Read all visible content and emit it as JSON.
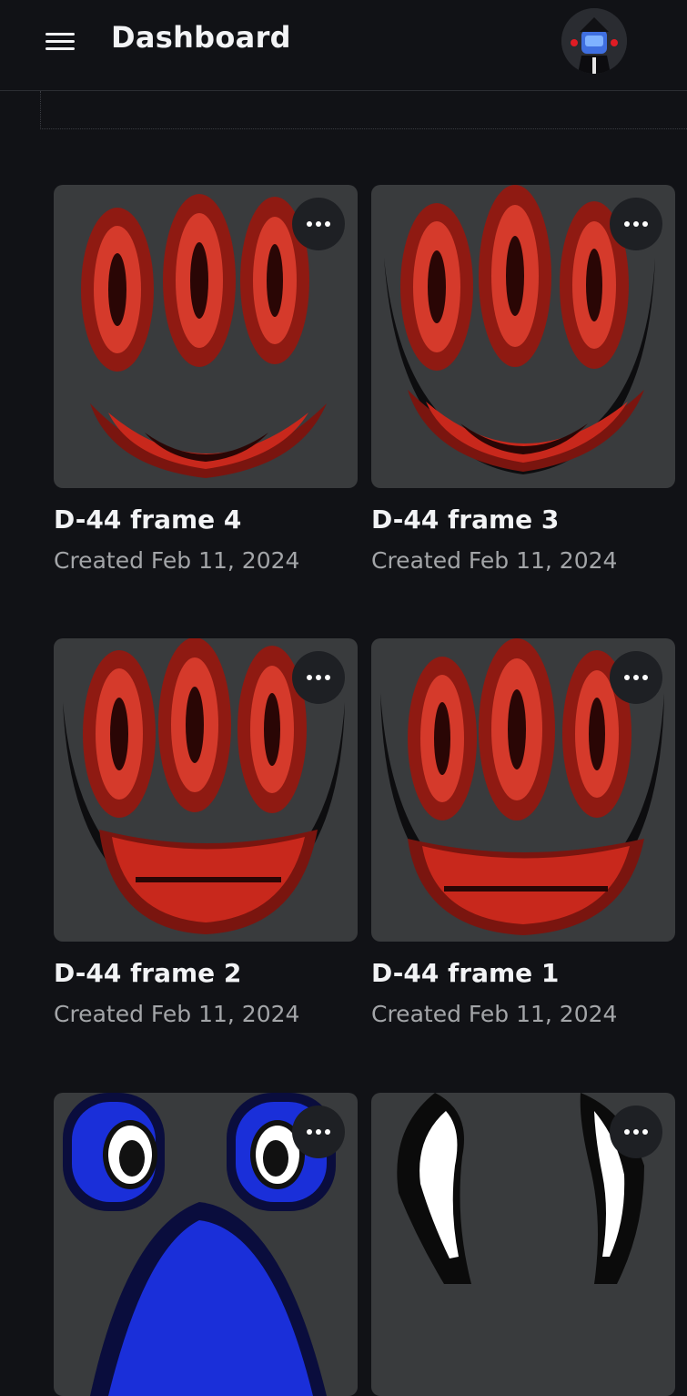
{
  "header": {
    "title": "Dashboard"
  },
  "creations": [
    {
      "name": "D-44 frame 4",
      "created": "Created Feb 11, 2024"
    },
    {
      "name": "D-44 frame 3",
      "created": "Created Feb 11, 2024"
    },
    {
      "name": "D-44 frame 2",
      "created": "Created Feb 11, 2024"
    },
    {
      "name": "D-44 frame 1",
      "created": "Created Feb 11, 2024"
    },
    {
      "name": "",
      "created": ""
    },
    {
      "name": "",
      "created": ""
    }
  ],
  "colors": {
    "background": "#111216",
    "card_thumb": "#393b3d",
    "text_primary": "#f2f3f5",
    "text_secondary": "#a3a5a8",
    "face_red": "#c8281c",
    "face_blue": "#1a2fd9"
  },
  "icons": {
    "menu": "hamburger-icon",
    "more": "more-horizontal-icon"
  }
}
